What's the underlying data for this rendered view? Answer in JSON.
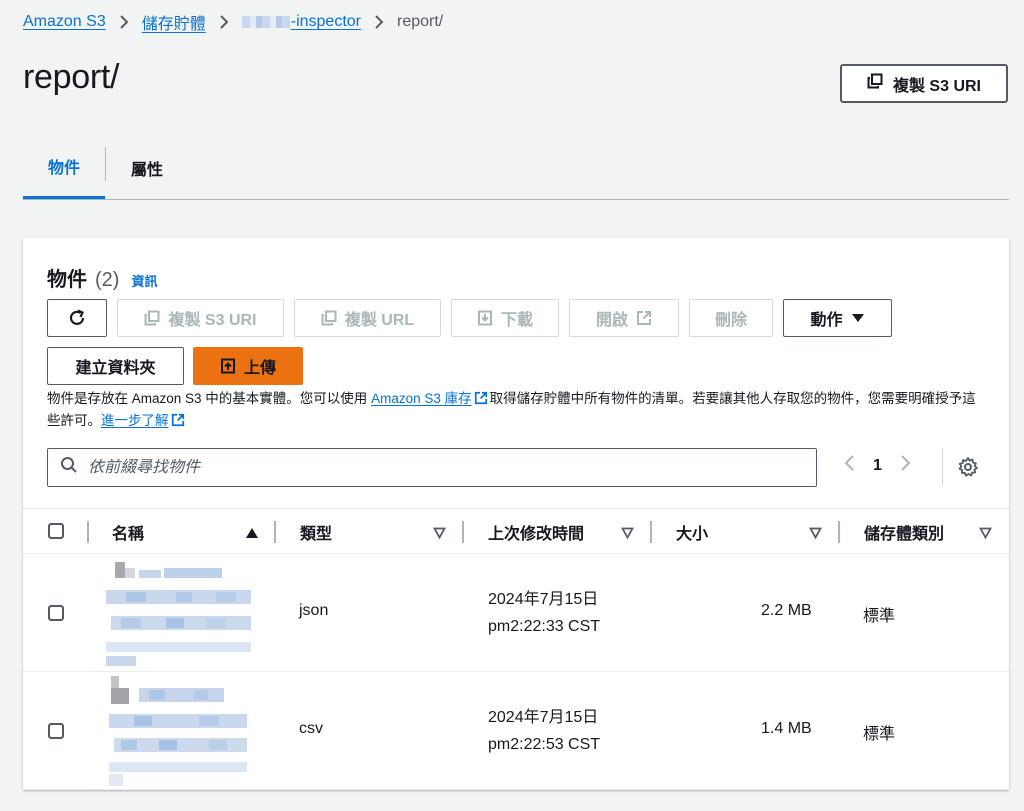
{
  "breadcrumb": {
    "items": [
      "Amazon S3",
      "儲存貯體",
      "-inspector"
    ],
    "current": "report/"
  },
  "page": {
    "title": "report/",
    "copy_uri_label": "複製 S3 URI"
  },
  "tabs": [
    {
      "label": "物件",
      "active": true
    },
    {
      "label": "屬性",
      "active": false
    }
  ],
  "panel": {
    "title": "物件",
    "count": "(2)",
    "info": "資訊"
  },
  "toolbar": {
    "refresh": "refresh",
    "copy_s3_uri": "複製 S3 URI",
    "copy_url": "複製 URL",
    "download": "下載",
    "open": "開啟",
    "delete": "刪除",
    "actions": "動作",
    "create_folder": "建立資料夾",
    "upload": "上傳"
  },
  "description": {
    "part1": "物件是存放在 Amazon S3 中的基本實體。您可以使用",
    "link1": "Amazon S3 庫存",
    "part2": "取得儲存貯體中所有物件的清單。若要讓其他人存取您的物件，您需要明確授予這些許可。",
    "link2": "進一步了解"
  },
  "search": {
    "placeholder": "依前綴尋找物件",
    "value": ""
  },
  "pagination": {
    "page": "1"
  },
  "table": {
    "columns": [
      "名稱",
      "類型",
      "上次修改時間",
      "大小",
      "儲存體類別"
    ],
    "rows": [
      {
        "type": "json",
        "date": "2024年7月15日",
        "time": "pm2:22:33 CST",
        "size": "2.2 MB",
        "storage_class": "標準"
      },
      {
        "type": "csv",
        "date": "2024年7月15日",
        "time": "pm2:22:53 CST",
        "size": "1.4 MB",
        "storage_class": "標準"
      }
    ]
  },
  "colors": {
    "link": "#0972d3",
    "primary_button": "#ec7211",
    "background": "#f2f3f3"
  }
}
